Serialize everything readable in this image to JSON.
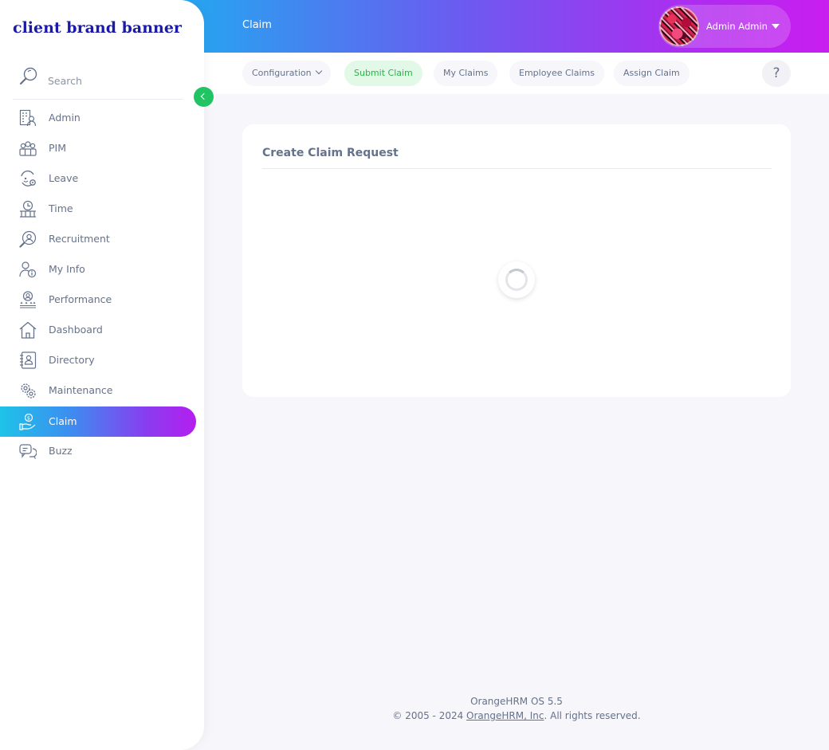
{
  "brand": {
    "text": "client brand banner"
  },
  "header": {
    "module_title": "Claim",
    "user_name": "Admin Admin"
  },
  "subnav": {
    "tabs": [
      {
        "label": "Configuration",
        "has_dropdown": true,
        "active": false
      },
      {
        "label": "Submit Claim",
        "active": true
      },
      {
        "label": "My Claims",
        "active": false
      },
      {
        "label": "Employee Claims",
        "active": false
      },
      {
        "label": "Assign Claim",
        "active": false
      }
    ],
    "help_label": "?"
  },
  "sidebar": {
    "search": {
      "placeholder": "Search",
      "value": ""
    },
    "items": [
      {
        "label": "Admin",
        "icon": "admin-icon"
      },
      {
        "label": "PIM",
        "icon": "pim-icon"
      },
      {
        "label": "Leave",
        "icon": "leave-icon"
      },
      {
        "label": "Time",
        "icon": "time-icon"
      },
      {
        "label": "Recruitment",
        "icon": "recruitment-icon"
      },
      {
        "label": "My Info",
        "icon": "my-info-icon"
      },
      {
        "label": "Performance",
        "icon": "performance-icon"
      },
      {
        "label": "Dashboard",
        "icon": "dashboard-icon"
      },
      {
        "label": "Directory",
        "icon": "directory-icon"
      },
      {
        "label": "Maintenance",
        "icon": "maintenance-icon"
      },
      {
        "label": "Claim",
        "icon": "claim-icon",
        "active": true
      },
      {
        "label": "Buzz",
        "icon": "buzz-icon"
      }
    ]
  },
  "main": {
    "card_title": "Create Claim Request",
    "loading": true
  },
  "footer": {
    "version": "OrangeHRM OS 5.5",
    "copyright_prefix": "© 2005 - 2024 ",
    "company_link": "OrangeHRM, Inc",
    "copyright_suffix": ". All rights reserved."
  },
  "colors": {
    "accent_green": "#21c462",
    "active_tab_bg": "#e3f9e8",
    "active_tab_text": "#2bb24a",
    "text_muted": "#64728c",
    "brand_text": "#1a1aa8"
  }
}
